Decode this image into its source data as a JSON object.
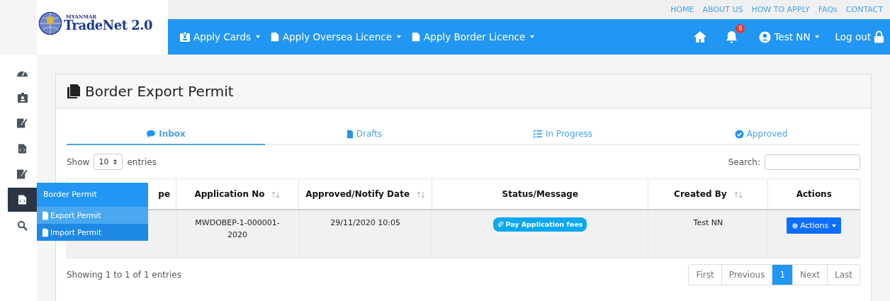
{
  "logo": {
    "top": "MYANMAR",
    "name": "TradeNet 2.0"
  },
  "top_links": [
    "HOME",
    "ABOUT US",
    "HOW TO APPLY",
    "FAQs",
    "CONTACT"
  ],
  "nav": [
    {
      "kind": "card",
      "label": "Apply Cards"
    },
    {
      "kind": "file",
      "label": "Apply Oversea Licence"
    },
    {
      "kind": "file",
      "label": "Apply Border Licence"
    }
  ],
  "notifications": {
    "count": "6"
  },
  "user": {
    "name": "Test NN",
    "logout": "Log out"
  },
  "sidebar": {
    "items": [
      {
        "kind": "gauge",
        "selected": false
      },
      {
        "kind": "badge",
        "selected": false
      },
      {
        "kind": "sign",
        "selected": false
      },
      {
        "kind": "code",
        "selected": false
      },
      {
        "kind": "sign",
        "selected": false
      },
      {
        "kind": "code",
        "selected": true
      },
      {
        "kind": "search",
        "selected": false
      }
    ],
    "flyout": {
      "title": "Border Permit",
      "items": [
        {
          "label": "Export Permit",
          "selected": true
        },
        {
          "label": "Import Permit",
          "selected": false
        }
      ]
    }
  },
  "page": {
    "title": "Border Export Permit"
  },
  "tabs": [
    {
      "kind": "comment",
      "label": "Inbox",
      "selected": true
    },
    {
      "kind": "file",
      "label": "Drafts",
      "selected": false
    },
    {
      "kind": "list",
      "label": "In Progress",
      "selected": false
    },
    {
      "kind": "check",
      "label": "Approved",
      "selected": false
    }
  ],
  "length": {
    "before": "Show",
    "value": "10",
    "after": "entries"
  },
  "search": {
    "label": "Search:"
  },
  "table": {
    "columns": [
      {
        "label": "pe",
        "sortable": false
      },
      {
        "label": "Application No",
        "sortable": true
      },
      {
        "label": "Approved/Notify Date",
        "sortable": true
      },
      {
        "label": "Status/Message",
        "sortable": false
      },
      {
        "label": "Created By",
        "sortable": true
      },
      {
        "label": "Actions",
        "sortable": false
      }
    ],
    "rows": [
      {
        "column_1": "",
        "application_no": "MWDOBEP-1-000001-2020",
        "date": "29/11/2020 10:05",
        "status": "Pay Application fees",
        "created_by": "Test NN",
        "action": "Actions"
      }
    ]
  },
  "info": "Showing 1 to 1 of 1 entries",
  "pagination": [
    {
      "label": "First",
      "selected": false
    },
    {
      "label": "Previous",
      "selected": false
    },
    {
      "label": "1",
      "selected": true
    },
    {
      "label": "Next",
      "selected": false
    },
    {
      "label": "Last",
      "selected": false
    }
  ]
}
